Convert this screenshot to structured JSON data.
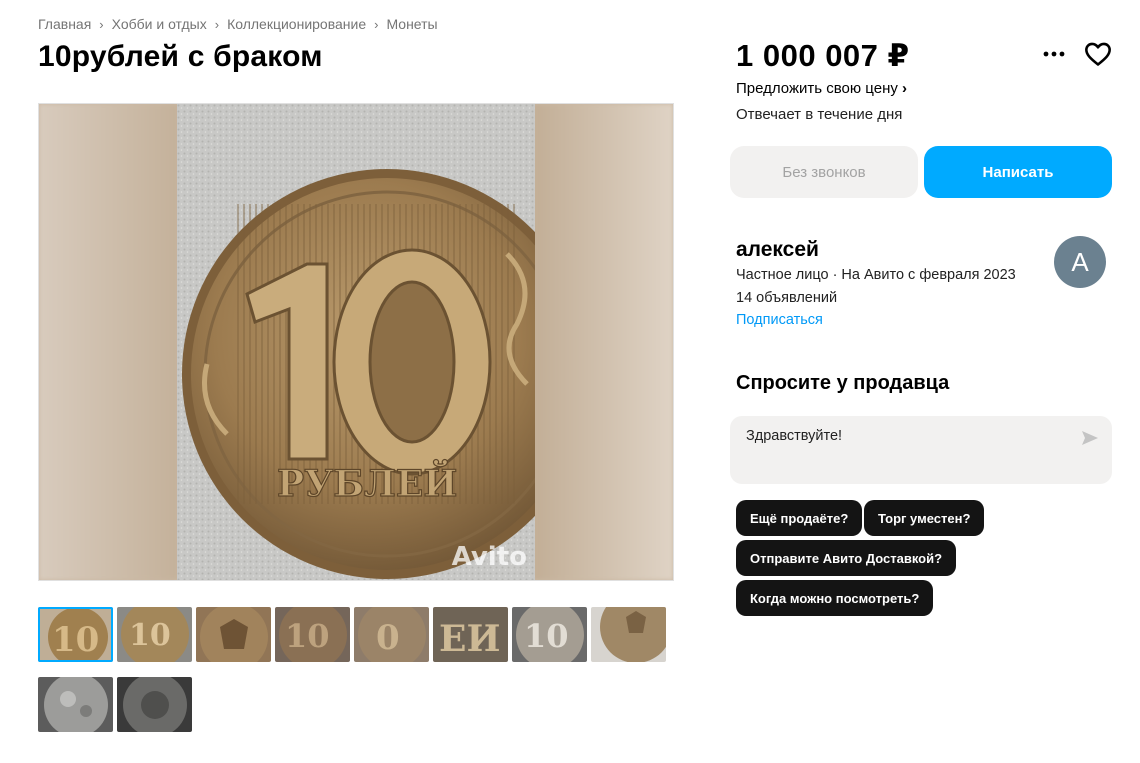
{
  "breadcrumb": [
    "Главная",
    "Хобби и отдых",
    "Коллекционирование",
    "Монеты"
  ],
  "title": "10рублей с браком",
  "gallery": {
    "watermark": "Avito",
    "coin_main": {
      "denomination": "10",
      "label": "РУБЛЕЙ"
    },
    "thumbnails": [
      {
        "icon": "coin-10-photo",
        "active": true
      },
      {
        "icon": "coin-10-rubley-photo",
        "active": false
      },
      {
        "icon": "coin-eagle-photo",
        "active": false
      },
      {
        "icon": "coin-10-closeup-photo",
        "active": false
      },
      {
        "icon": "coin-10-rotated-photo",
        "active": false
      },
      {
        "icon": "coin-letters-photo",
        "active": false
      },
      {
        "icon": "coin-10-silver-photo",
        "active": false
      },
      {
        "icon": "coin-eagle-edge-photo",
        "active": false
      },
      {
        "icon": "coin-grey-photo",
        "active": false
      },
      {
        "icon": "coin-dark-photo",
        "active": false
      }
    ]
  },
  "price": "1 000 007 ₽",
  "offer_link": "Предложить свою цену",
  "response_time": "Отвечает в течение дня",
  "buttons": {
    "no_calls": "Без звонков",
    "write": "Написать"
  },
  "seller": {
    "name": "алексей",
    "info": "Частное лицо · На Авито с февраля 2023",
    "ads": "14 объявлений",
    "subscribe": "Подписаться",
    "avatar_letter": "А"
  },
  "ask": {
    "title": "Спросите у продавца",
    "input_value": "Здравствуйте!",
    "chips": [
      "Ещё продаёте?",
      "Торг уместен?",
      "Отправите Авито Доставкой?",
      "Когда можно посмотреть?"
    ]
  },
  "colors": {
    "accent": "#00aaff",
    "link": "#0099f7",
    "chip": "#141414",
    "avatar": "#6b8190"
  }
}
